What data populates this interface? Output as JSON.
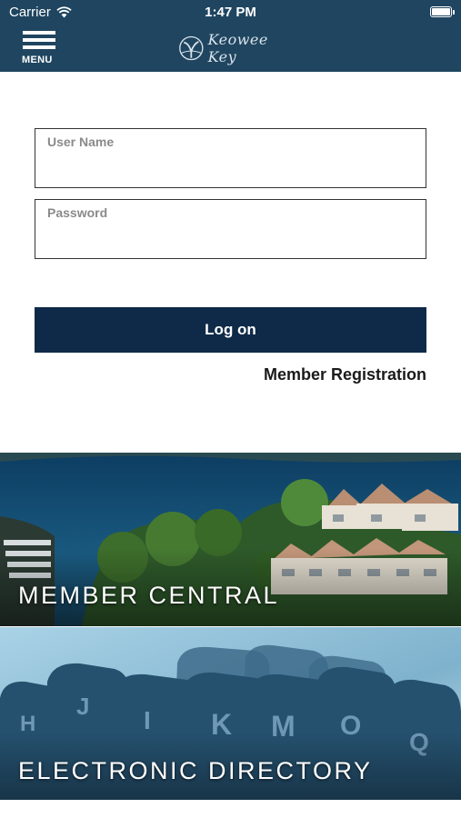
{
  "status_bar": {
    "carrier": "Carrier",
    "time": "1:47 PM",
    "wifi_icon": "wifi-icon",
    "battery_icon": "battery-icon"
  },
  "nav": {
    "menu_label": "MENU",
    "menu_icon": "hamburger-icon",
    "logo_text": "Keowee Key",
    "background_color": "#1f4560"
  },
  "login": {
    "username_placeholder": "User Name",
    "username_value": "",
    "password_placeholder": "Password",
    "password_value": "",
    "submit_label": "Log on",
    "button_color": "#0f2a48",
    "registration_label": "Member Registration"
  },
  "tiles": [
    {
      "label": "MEMBER CENTRAL",
      "image": "aerial-lake-condos-photo"
    },
    {
      "label": "ELECTRONIC DIRECTORY",
      "image": "file-index-tabs-photo"
    }
  ]
}
